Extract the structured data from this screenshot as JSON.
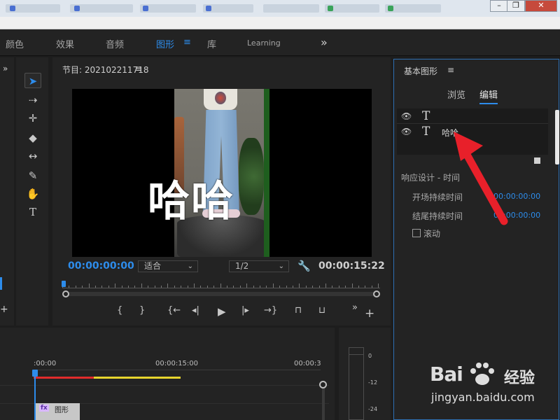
{
  "workspaces": {
    "color": "颜色",
    "effects": "效果",
    "audio": "音频",
    "graphics": "图形",
    "libraries": "库",
    "learning": "Learning",
    "more": "»",
    "menu": "≡"
  },
  "program": {
    "title": "节目: 202102211718",
    "menu": "≡",
    "overlay_text": "哈哈",
    "timecode": "00:00:00:00",
    "fit": "适合",
    "resolution": "1/2",
    "caret": "⌄",
    "duration": "00:00:15:22",
    "transport": {
      "mark_in": "{",
      "mark_out": "}",
      "go_in": "{←",
      "step_back": "◂|",
      "play": "▶",
      "step_forward": "|▸",
      "go_out": "→}",
      "lift": "⊓",
      "extract": "⊔",
      "more": "»",
      "add": "+"
    }
  },
  "essential_graphics": {
    "title": "基本图形",
    "menu": "≡",
    "tab_browse": "浏览",
    "tab_edit": "编辑",
    "layers": [
      {
        "name": ""
      },
      {
        "name": "哈哈"
      }
    ],
    "eye": "👁",
    "text_icon": "T",
    "responsive_title": "响应设计 - 时间",
    "intro_label": "开场持续时间",
    "intro_value": "00:00:00:00",
    "outro_label": "结尾持续时间",
    "outro_value": "00:00:00:00",
    "roll_label": "滚动"
  },
  "timeline": {
    "ruler_start": ":00:00",
    "ruler_mid": "00:00:15:00",
    "ruler_end": "00:00:3",
    "clip_fx": "fx",
    "clip_name": "图形"
  },
  "audio_meter": {
    "db_0": "0",
    "db_12": "-12",
    "db_24": "-24"
  },
  "watermark": {
    "logo": "Bai",
    "site": "经验",
    "url": "jingyan.baidu.com"
  },
  "icons": {
    "select": "selection-tool",
    "track_select": "track-select-tool",
    "ripple": "ripple-edit-tool",
    "razor": "razor-tool",
    "slip": "slip-tool",
    "pen": "pen-tool",
    "hand": "hand-tool",
    "type": "type-tool"
  },
  "colors": {
    "accent": "#2d8ceb",
    "annotation_arrow": "#e8202a",
    "render_red": "#e02b2b",
    "render_yellow": "#e7d42d"
  }
}
